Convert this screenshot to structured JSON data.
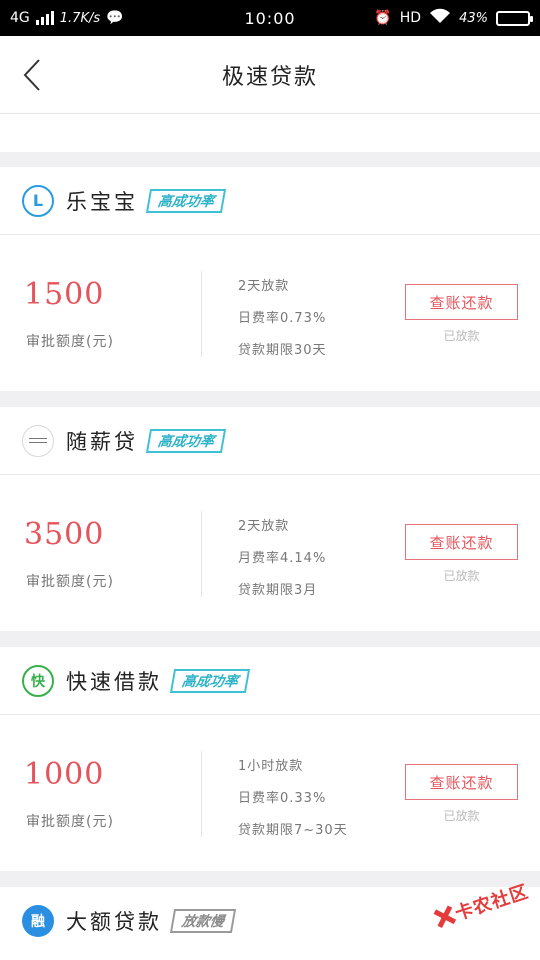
{
  "status_bar": {
    "network": "4G",
    "speed": "1.7K/s",
    "time": "10:00",
    "hd": "HD",
    "battery_percent": "43%",
    "battery_level": 0.43
  },
  "header": {
    "title": "极速贷款"
  },
  "colors": {
    "accent_red": "#e5545a",
    "badge_cyan": "#3fc1d4"
  },
  "loans": [
    {
      "name": "乐宝宝",
      "logo_icon": "lebaobao-logo-icon",
      "badge": "高成功率",
      "amount": "1500",
      "amount_label": "审批额度(元)",
      "info_1": "2天放款",
      "info_2": "日费率0.73%",
      "info_3": "贷款期限30天",
      "action": "查账还款",
      "status": "已放款"
    },
    {
      "name": "随薪贷",
      "logo_icon": "suixindai-logo-icon",
      "badge": "高成功率",
      "amount": "3500",
      "amount_label": "审批额度(元)",
      "info_1": "2天放款",
      "info_2": "月费率4.14%",
      "info_3": "贷款期限3月",
      "action": "查账还款",
      "status": "已放款"
    },
    {
      "name": "快速借款",
      "logo_icon": "kuaisu-logo-icon",
      "badge": "高成功率",
      "amount": "1000",
      "amount_label": "审批额度(元)",
      "info_1": "1小时放款",
      "info_2": "日费率0.33%",
      "info_3": "贷款期限7~30天",
      "action": "查账还款",
      "status": "已放款"
    },
    {
      "name": "大额贷款",
      "logo_icon": "dae-logo-icon",
      "badge": "放款慢"
    }
  ],
  "watermark": {
    "text": "卡农社区"
  }
}
